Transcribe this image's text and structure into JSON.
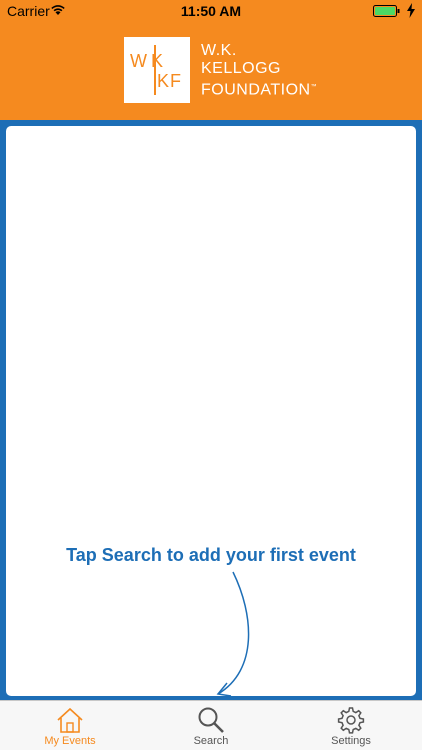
{
  "status_bar": {
    "carrier": "Carrier",
    "time": "11:50 AM",
    "icons": [
      "wifi-icon",
      "battery-icon",
      "charging-bolt-icon"
    ]
  },
  "header": {
    "logo_mark": "WK KF",
    "logo_lines": [
      "W.K.",
      "KELLOGG",
      "FOUNDATION"
    ],
    "trademark": "™"
  },
  "main": {
    "empty_hint": "Tap Search to add your first event"
  },
  "tabbar": {
    "tabs": [
      {
        "label": "My Events",
        "icon": "home-icon",
        "selected": true
      },
      {
        "label": "Search",
        "icon": "search-icon",
        "selected": false
      },
      {
        "label": "Settings",
        "icon": "gear-icon",
        "selected": false
      }
    ]
  },
  "colors": {
    "header_orange": "#f58a1f",
    "frame_blue": "#1d6eb6",
    "selected_tab": "#f58a1f"
  }
}
